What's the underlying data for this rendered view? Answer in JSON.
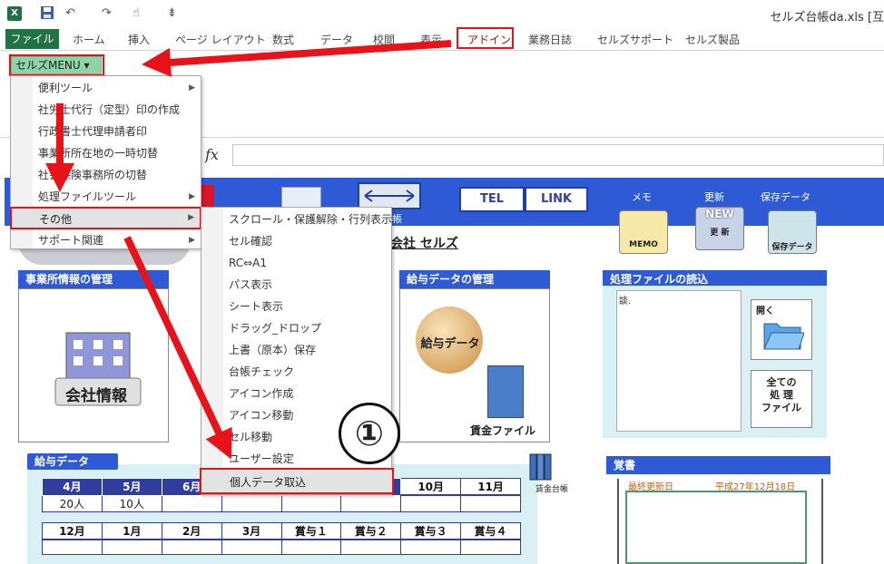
{
  "window": {
    "title": "セルズ台帳da.xls [互",
    "excel_logo": "X"
  },
  "qat": {
    "undo": "↶",
    "redo": "↷",
    "touch": "☝",
    "customize": "⇟"
  },
  "ribbon": {
    "tabs": [
      "ファイル",
      "ホーム",
      "挿入",
      "ページ レイアウト",
      "数式",
      "データ",
      "校閲",
      "表示",
      "アドイン",
      "業務日誌",
      "セルズサポート",
      "セルズ製品"
    ],
    "addin_button": "セルズMENU ▾"
  },
  "formula_bar": {
    "fx": "fx"
  },
  "menu1": {
    "items": [
      {
        "label": "便利ツール",
        "submenu": true
      },
      {
        "label": "社労士代行（定型）印の作成",
        "submenu": false
      },
      {
        "label": "行政書士代理申請者印",
        "submenu": false
      },
      {
        "label": "事業所所在地の一時切替",
        "submenu": false
      },
      {
        "label": "社会保険事務所の切替",
        "submenu": false
      },
      {
        "label": "処理ファイルツール",
        "submenu": true
      },
      {
        "label": "その他",
        "submenu": true
      },
      {
        "label": "サポート関連",
        "submenu": true
      }
    ],
    "arrow": "▶"
  },
  "menu2": {
    "items": [
      "スクロール・保護解除・行列表示",
      "セル確認",
      "RC⇔A1",
      "パス表示",
      "シート表示",
      "ドラッグ_ドロップ",
      "上書（原本）保存",
      "台帳チェック",
      "アイコン作成",
      "アイコン移動",
      "セル移動",
      "ユーザー設定",
      "個人データ取込"
    ]
  },
  "annotation": {
    "circle_number": "①"
  },
  "sheet": {
    "header_buttons": [
      "TEL",
      "LINK"
    ],
    "header_labels": [
      "メモ",
      "更新",
      "保存データ"
    ],
    "header_tail": "帳",
    "icons": {
      "memo": "MEMO",
      "update_new": "NEW",
      "update_body": "更 新",
      "save": "保存データ"
    },
    "company_name": "会社 セルズ",
    "panels": {
      "jigyosho": "事業所情報の管理",
      "kyuyo": "給与データの管理",
      "load": "処理ファイルの読込",
      "memo": "覚書",
      "kyuyo_data": "給与データ"
    },
    "kaisha_label": "会社情報",
    "kyuyo_label": "給与データ",
    "binder_label": "賃金ファイル",
    "load_text": "談.",
    "open_label": "開く",
    "all_label": "全ての\n処 理\nファイル",
    "memo_date_label": "最終更新日",
    "memo_date": "平成27年12月18日",
    "daicho_label": "賃金台帳",
    "grid1_head": [
      "4月",
      "5月",
      "6月",
      "",
      "",
      "",
      "10月",
      "11月"
    ],
    "grid1_row": [
      "20人",
      "10人",
      "",
      "",
      "",
      "",
      "",
      ""
    ],
    "grid2_head": [
      "12月",
      "1月",
      "2月",
      "3月",
      "賞与１",
      "賞与２",
      "賞与３",
      "賞与４"
    ],
    "grid2_row": [
      "",
      "",
      "",
      "",
      "",
      "",
      "",
      ""
    ]
  },
  "colors": {
    "excel_green": "#217346",
    "sheet_blue": "#2f5ad6",
    "grid_blue": "#2f3e9e",
    "highlight_red": "#e8121b",
    "addin_green": "#8fd3a8"
  }
}
